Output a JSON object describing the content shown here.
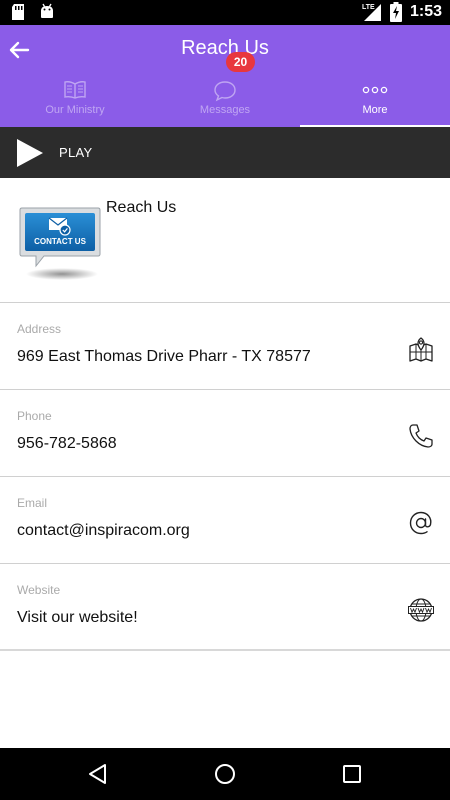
{
  "status_bar": {
    "time": "1:53",
    "network": "LTE",
    "icons": [
      "sd-card-icon",
      "android-icon",
      "lte-signal-icon",
      "battery-charging-icon"
    ]
  },
  "header": {
    "title": "Reach Us",
    "back_icon": "arrow-left-icon",
    "background_color": "#8b5ce8"
  },
  "tabs": [
    {
      "label": "Our Ministry",
      "icon": "book-icon",
      "active": false
    },
    {
      "label": "Messages",
      "icon": "chat-bubble-icon",
      "active": false,
      "badge": "20"
    },
    {
      "label": "More",
      "icon": "more-dots-icon",
      "active": true
    }
  ],
  "player": {
    "label": "PLAY",
    "icon": "play-icon"
  },
  "section": {
    "title": "Reach Us",
    "logo_text": "CONTACT US"
  },
  "contact_rows": [
    {
      "label": "Address",
      "value": "969 East Thomas Drive Pharr - TX 78577",
      "icon": "map-location-icon"
    },
    {
      "label": "Phone",
      "value": "956-782-5868",
      "icon": "phone-icon"
    },
    {
      "label": "Email",
      "value": "contact@inspiracom.org",
      "icon": "at-sign-icon"
    },
    {
      "label": "Website",
      "value": "Visit our website!",
      "icon": "globe-www-icon"
    }
  ],
  "nav_bar": {
    "icons": [
      "back-triangle-icon",
      "home-circle-icon",
      "recents-square-icon"
    ]
  },
  "colors": {
    "accent": "#8b5ce8",
    "badge": "#e8373e",
    "player_bar": "#2c2c2c"
  }
}
